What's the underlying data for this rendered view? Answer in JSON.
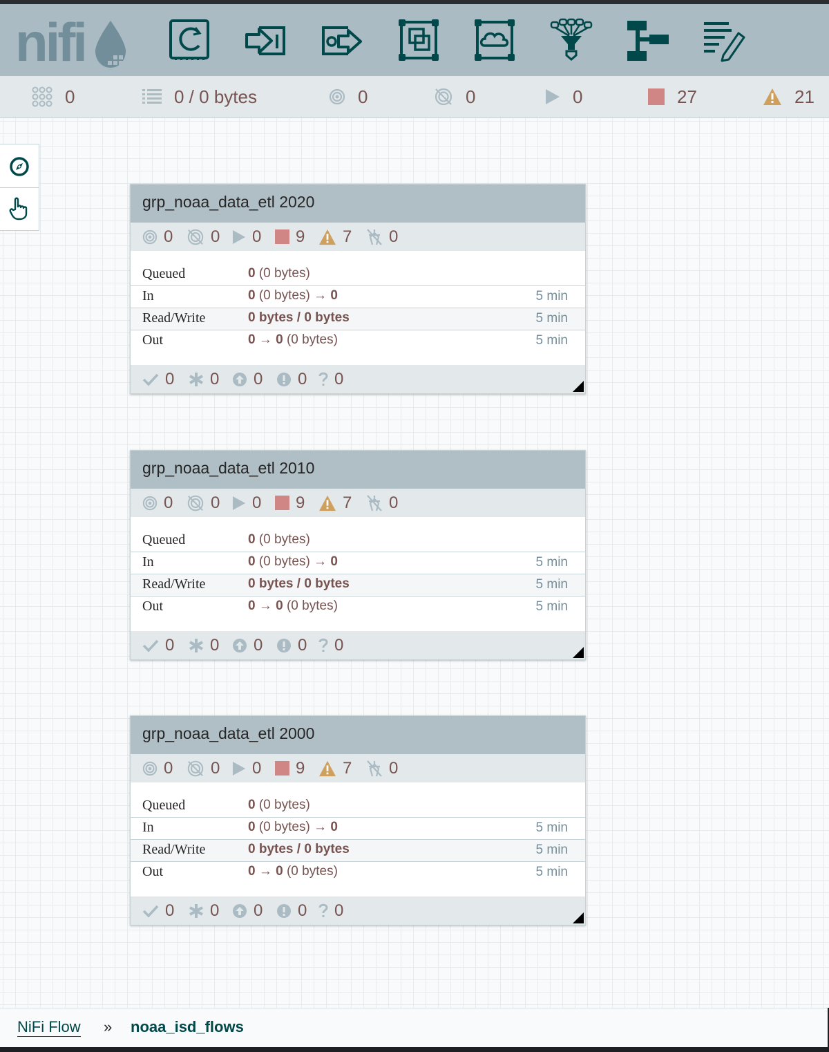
{
  "logo": {
    "text": "nifi"
  },
  "toolbar": {
    "buttons": [
      {
        "name": "processor-tool-icon"
      },
      {
        "name": "input-port-tool-icon"
      },
      {
        "name": "output-port-tool-icon"
      },
      {
        "name": "process-group-tool-icon"
      },
      {
        "name": "remote-process-group-tool-icon"
      },
      {
        "name": "funnel-tool-icon"
      },
      {
        "name": "template-tool-icon"
      },
      {
        "name": "label-tool-icon"
      }
    ]
  },
  "status": {
    "active_threads": "0",
    "queued": "0 / 0 bytes",
    "transmitting": "0",
    "not_transmitting": "0",
    "running": "0",
    "stopped": "27",
    "invalid": "21"
  },
  "groups": [
    {
      "title": "grp_noaa_data_etl 2020",
      "stats": {
        "transmitting": "0",
        "not_transmitting": "0",
        "running": "0",
        "stopped": "9",
        "invalid": "7",
        "disabled": "0"
      },
      "queued_a": "0",
      "queued_b": " (0 bytes)",
      "in_a": "0",
      "in_b": " (0 bytes) → ",
      "in_c": "0",
      "in_time": "5 min",
      "rw": "0 bytes / 0 bytes",
      "rw_time": "5 min",
      "out_a": "0 → 0",
      "out_b": " (0 bytes)",
      "out_time": "5 min",
      "foot": {
        "up_to_date": "0",
        "locally_modified": "0",
        "stale": "0",
        "sync_failure": "0",
        "unknown": "0"
      }
    },
    {
      "title": "grp_noaa_data_etl 2010",
      "stats": {
        "transmitting": "0",
        "not_transmitting": "0",
        "running": "0",
        "stopped": "9",
        "invalid": "7",
        "disabled": "0"
      },
      "queued_a": "0",
      "queued_b": " (0 bytes)",
      "in_a": "0",
      "in_b": " (0 bytes) → ",
      "in_c": "0",
      "in_time": "5 min",
      "rw": "0 bytes / 0 bytes",
      "rw_time": "5 min",
      "out_a": "0 → 0",
      "out_b": " (0 bytes)",
      "out_time": "5 min",
      "foot": {
        "up_to_date": "0",
        "locally_modified": "0",
        "stale": "0",
        "sync_failure": "0",
        "unknown": "0"
      }
    },
    {
      "title": "grp_noaa_data_etl 2000",
      "stats": {
        "transmitting": "0",
        "not_transmitting": "0",
        "running": "0",
        "stopped": "9",
        "invalid": "7",
        "disabled": "0"
      },
      "queued_a": "0",
      "queued_b": " (0 bytes)",
      "in_a": "0",
      "in_b": " (0 bytes) → ",
      "in_c": "0",
      "in_time": "5 min",
      "rw": "0 bytes / 0 bytes",
      "rw_time": "5 min",
      "out_a": "0 → 0",
      "out_b": " (0 bytes)",
      "out_time": "5 min",
      "foot": {
        "up_to_date": "0",
        "locally_modified": "0",
        "stale": "0",
        "sync_failure": "0",
        "unknown": "0"
      }
    }
  ],
  "row_labels": {
    "queued": "Queued",
    "in": "In",
    "rw": "Read/Write",
    "out": "Out"
  },
  "breadcrumb": {
    "root": "NiFi Flow",
    "separator": "»",
    "current": "noaa_isd_flows"
  },
  "colors": {
    "header": "#aabbc3",
    "accent": "#004849",
    "value": "#775351",
    "stopped": "#d18686",
    "warning": "#cf9f5d"
  }
}
